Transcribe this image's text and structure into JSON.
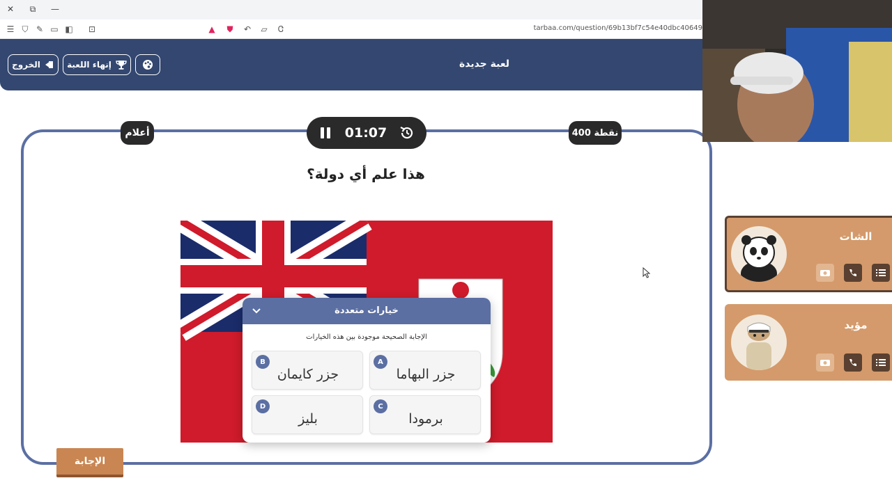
{
  "browser": {
    "url": "tarbaa.com/question/69b13bf7c54e40dbc40649",
    "window_controls": [
      "close-icon",
      "restore-icon",
      "minimize-icon"
    ]
  },
  "header": {
    "title": "لعبة جديدة",
    "exit_label": "الخروج",
    "end_game_label": "إنهاء اللعبة",
    "theme_icon": "palette-icon"
  },
  "game": {
    "category": "أعلام",
    "points": "400 نقطة",
    "timer": "01:07",
    "question": "هذا علم أي دولة؟",
    "answer_button": "الإجابة"
  },
  "multiple_choice": {
    "title": "خيارات متعددة",
    "subtitle": "الإجابة الصحيحة موجودة بين هذه الخيارات",
    "options": [
      {
        "letter": "A",
        "text": "جزر البهاما"
      },
      {
        "letter": "B",
        "text": "جزر كايمان"
      },
      {
        "letter": "C",
        "text": "برمودا"
      },
      {
        "letter": "D",
        "text": "بليز"
      }
    ]
  },
  "teams": [
    {
      "name": "الشات",
      "avatar": "panda-avatar"
    },
    {
      "name": "مؤيد",
      "avatar": "camel-avatar"
    }
  ],
  "colors": {
    "header_bg": "#334770",
    "board_border": "#5b6fa3",
    "team_card": "#d49a6b",
    "answer_button": "#c98652",
    "flag_red": "#cf1b2b",
    "flag_blue": "#1b2c6b"
  }
}
